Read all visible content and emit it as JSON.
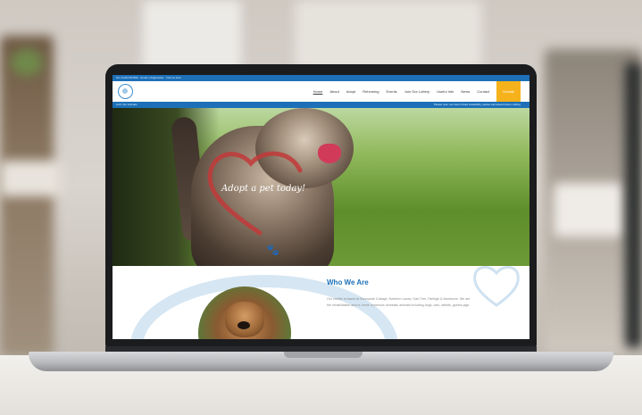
{
  "site": {
    "topbar_text": "Tel: 01234 567890 · Email: info@shelter · Find us here",
    "nav": [
      "Home",
      "About",
      "Adopt",
      "Rehoming",
      "Events",
      "Join Our Lottery",
      "Useful Info",
      "News",
      "Contact"
    ],
    "donate_label": "Donate",
    "bluebar_left": "Link: Our Animals",
    "bluebar_right": "Please note: we have limited availability, please call ahead before visiting",
    "hero_text": "Adopt a pet today!",
    "section_title": "Who We Are",
    "section_paragraph": "Our shelter is based at Sunnyside Cottage, Northern Lanes, Oak Tree, Farleigh & Newborne. We are the rehabilitation and re-home numerous domestic animals including dogs, cats, rabbits, guinea pigs."
  },
  "colors": {
    "brand_blue": "#1d70b8",
    "donate_yellow": "#f6b21a"
  },
  "icons": [
    "paw-icon",
    "heart-outline-icon",
    "logo-icon"
  ]
}
